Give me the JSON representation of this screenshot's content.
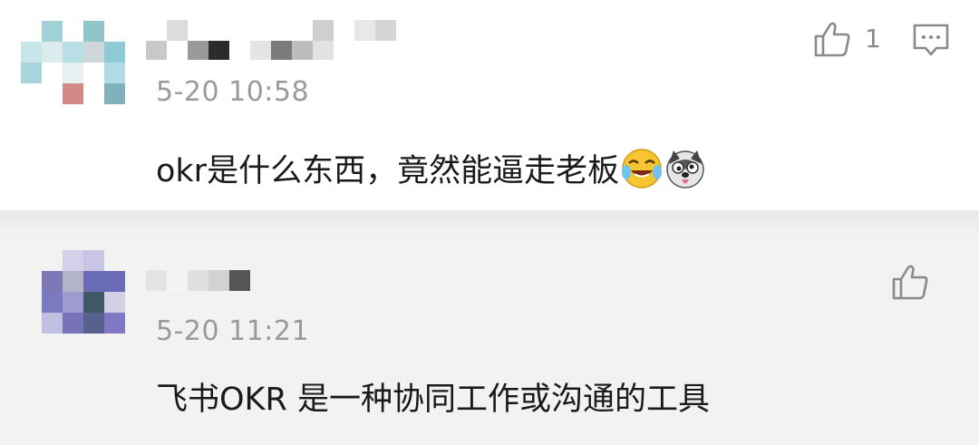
{
  "comments": [
    {
      "time": "5-20 10:58",
      "text": "okr是什么东西，竟然能逼走老板",
      "emojis": [
        "laughing-tears-emoji",
        "husky-dog-emoji"
      ],
      "like_count": "1",
      "icons": {
        "like": "thumbs-up-icon",
        "reply": "comment-icon"
      }
    },
    {
      "time": "5-20 11:21",
      "text": "飞书OKR 是一种协同工作或沟通的工具",
      "icons": {
        "like": "thumbs-up-icon"
      }
    }
  ],
  "colors": {
    "background": "#ffffff",
    "reply_background": "#f2f2f2",
    "text": "#1a1a1a",
    "meta": "#9a9a9a",
    "icon": "#8a8a8a"
  }
}
